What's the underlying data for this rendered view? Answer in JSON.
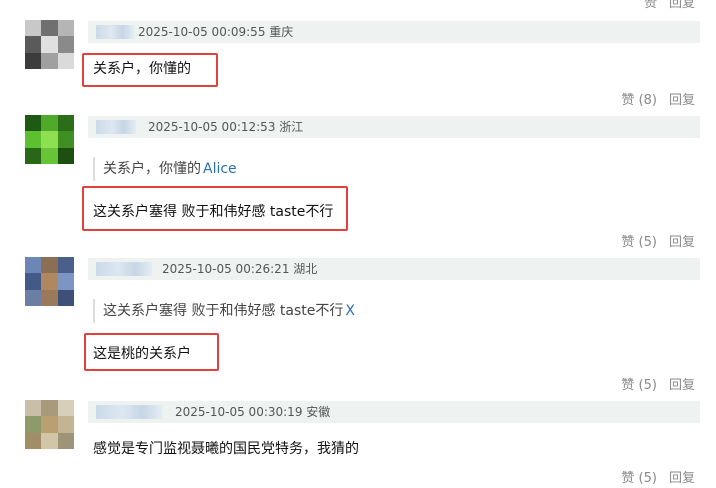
{
  "top_actions": {
    "like": "赞",
    "reply": "回复"
  },
  "comments": [
    {
      "time_location": "2025-10-05 00:09:55 重庆",
      "quote": null,
      "text": "关系户，你懂的",
      "like": "赞 (8)",
      "reply": "回复"
    },
    {
      "time_location": "2025-10-05 00:12:53 浙江",
      "quote": {
        "text": "关系户，你懂的",
        "author": "Alice"
      },
      "text": "这关系户塞得 败于和伟好感 taste不行",
      "like": "赞 (5)",
      "reply": "回复"
    },
    {
      "time_location": "2025-10-05 00:26:21 湖北",
      "quote": {
        "text": "这关系户塞得 败于和伟好感 taste不行",
        "author": "X"
      },
      "text": "这是桃的关系户",
      "like": "赞 (5)",
      "reply": "回复"
    },
    {
      "time_location": "2025-10-05 00:30:19 安徽",
      "quote": null,
      "text": "感觉是专门监视聂曦的国民党特务，我猜的",
      "like": "赞 (5)",
      "reply": "回复"
    }
  ],
  "colors": {
    "highlight": "#e0413a",
    "meta_bg": "#eef3f1",
    "quote_author": "#2a6fb5"
  }
}
